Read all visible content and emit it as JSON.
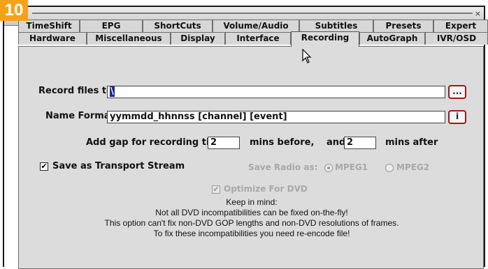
{
  "step_badge": "10",
  "titlebar": {
    "close_glyph": "×"
  },
  "tabs": {
    "row1": [
      "TimeShift",
      "EPG",
      "ShortCuts",
      "Volume/Audio",
      "Subtitles",
      "Presets",
      "Expert"
    ],
    "row2": [
      "Hardware",
      "Miscellaneous",
      "Display",
      "Interface",
      "Recording",
      "AutoGraph",
      "IVR/OSD"
    ],
    "active": "Recording"
  },
  "recording": {
    "record_files_label": "Record files to",
    "record_files_value": "\\",
    "browse_button": "...",
    "name_format_label": "Name Format",
    "name_format_value": "yymmdd_hhnnss [channel] [event]",
    "info_button": "i",
    "gap_label": "Add gap for recording time",
    "gap_before_value": "2",
    "mins_before_label": "mins before,",
    "and_label": "and",
    "gap_after_value": "2",
    "mins_after_label": "mins after",
    "transport_stream_label": "Save as Transport Stream",
    "transport_stream_checked": true,
    "save_radio_label": "Save Radio as:",
    "radio_options": [
      "MPEG1",
      "MPEG2"
    ],
    "radio_selected": "MPEG1",
    "optimize_dvd_label": "Optimize For DVD",
    "optimize_dvd_checked": true,
    "note_lines": [
      "Keep in mind:",
      "Not all DVD incompatibilities can be fixed on-the-fly!",
      "This option can't fix non-DVD GOP lengths and non-DVD resolutions of frames.",
      "To fix these incompatibilities you need re-encode file!"
    ]
  },
  "icons": {
    "cursor": "mouse-pointer-icon",
    "close": "close-icon",
    "checkmark": "checkmark-icon"
  }
}
